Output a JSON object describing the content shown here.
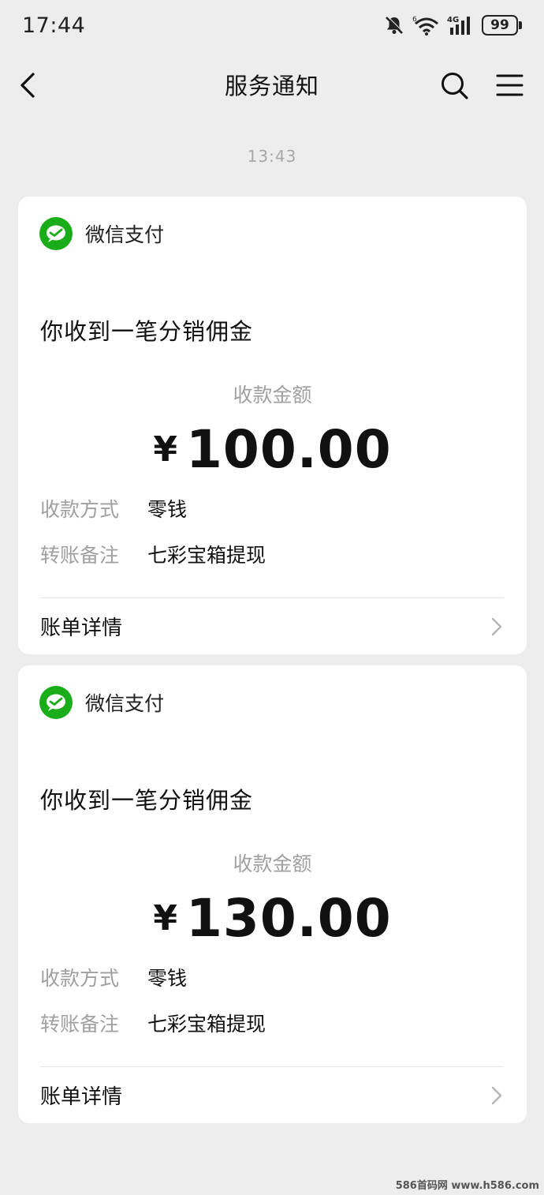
{
  "status_bar": {
    "time": "17:44",
    "battery": "99",
    "icons": [
      "mute-bell-icon",
      "wifi-icon",
      "signal-4g-icon",
      "battery-icon"
    ]
  },
  "nav": {
    "title": "服务通知",
    "icons": [
      "back-arrow-icon",
      "search-icon",
      "menu-icon"
    ]
  },
  "timestamp": "13:43",
  "cards": [
    {
      "pay_name": "微信支付",
      "title": "你收到一笔分销佣金",
      "amount_label": "收款金额",
      "currency": "¥",
      "amount": "100.00",
      "method_label": "收款方式",
      "method_value": "零钱",
      "remark_label": "转账备注",
      "remark_value": "七彩宝箱提现",
      "detail_label": "账单详情"
    },
    {
      "pay_name": "微信支付",
      "title": "你收到一笔分销佣金",
      "amount_label": "收款金额",
      "currency": "¥",
      "amount": "130.00",
      "method_label": "收款方式",
      "method_value": "零钱",
      "remark_label": "转账备注",
      "remark_value": "七彩宝箱提现",
      "detail_label": "账单详情"
    }
  ],
  "colors": {
    "background": "#ededed",
    "wechat_pay_green": "#1aad19",
    "muted_text": "#a0a0a0"
  },
  "watermark": "586首码网 www.h586.com"
}
